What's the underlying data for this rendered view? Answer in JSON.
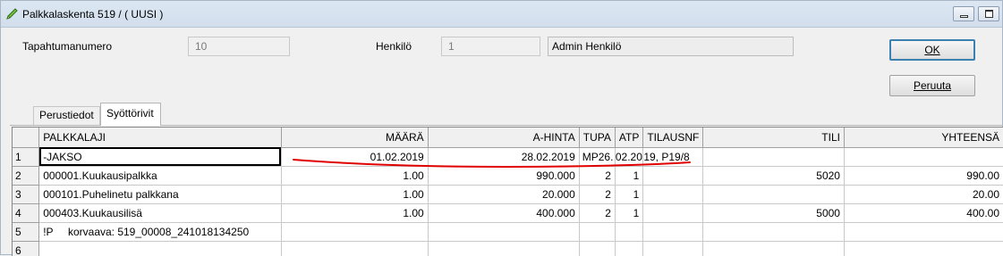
{
  "window": {
    "title": "Palkkalaskenta 519  / ( UUSI )",
    "icon": "pencil-icon",
    "buttons": [
      "minimize-icon",
      "maximize-icon"
    ]
  },
  "header": {
    "tapahtumanumero_label": "Tapahtumanumero",
    "tapahtumanumero_value": "10",
    "henkilo_label": "Henkilö",
    "henkilo_id": "1",
    "henkilo_name": "Admin Henkilö"
  },
  "actions": {
    "ok_label": "OK",
    "cancel_label": "Peruuta"
  },
  "tabs": [
    "Perustiedot",
    "Syöttörivit"
  ],
  "active_tab": "Syöttörivit",
  "grid": {
    "columns": [
      "",
      "PALKKALAJI",
      "MÄÄRÄ",
      "A-HINTA",
      "TUPA",
      "ATP",
      "TILAUSNF",
      "TILI",
      "YHTEENSÄ"
    ],
    "rows": [
      {
        "num": "1",
        "palkkalaji": "-JAKSO",
        "maara": "01.02.2019",
        "ahinta": "28.02.2019",
        "tupa": "MP26.",
        "atp": "02.20",
        "tilaus": "19, P19/8",
        "tili": "",
        "yhteensa": ""
      },
      {
        "num": "2",
        "palkkalaji": "000001.Kuukausipalkka",
        "maara": "1.00",
        "ahinta": "990.000",
        "tupa": "2",
        "atp": "1",
        "tilaus": "",
        "tili": "5020",
        "yhteensa": "990.00"
      },
      {
        "num": "3",
        "palkkalaji": "000101.Puhelinetu palkkana",
        "maara": "1.00",
        "ahinta": "20.000",
        "tupa": "2",
        "atp": "1",
        "tilaus": "",
        "tili": "",
        "yhteensa": "20.00"
      },
      {
        "num": "4",
        "palkkalaji": "000403.Kuukausilisä",
        "maara": "1.00",
        "ahinta": "400.000",
        "tupa": "2",
        "atp": "1",
        "tilaus": "",
        "tili": "5000",
        "yhteensa": "400.00"
      },
      {
        "num": "5",
        "palkkalaji": "!P     korvaava: 519_00008_241018134250",
        "maara": "",
        "ahinta": "",
        "tupa": "",
        "atp": "",
        "tilaus": "",
        "tili": "",
        "yhteensa": ""
      },
      {
        "num": "6",
        "palkkalaji": "",
        "maara": "",
        "ahinta": "",
        "tupa": "",
        "atp": "",
        "tilaus": "",
        "tili": "",
        "yhteensa": ""
      }
    ]
  },
  "annotation_color": "#e00000"
}
